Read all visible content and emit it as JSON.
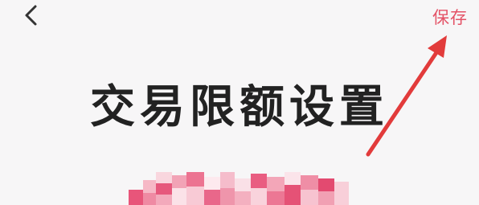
{
  "header": {
    "back_icon": "chevron-left-icon",
    "save_label": "保存"
  },
  "main": {
    "title": "交易限额设置"
  },
  "colors": {
    "accent": "#e45367",
    "arrow": "#e23b3b",
    "title": "#222222",
    "background": "#f7f6f7"
  }
}
